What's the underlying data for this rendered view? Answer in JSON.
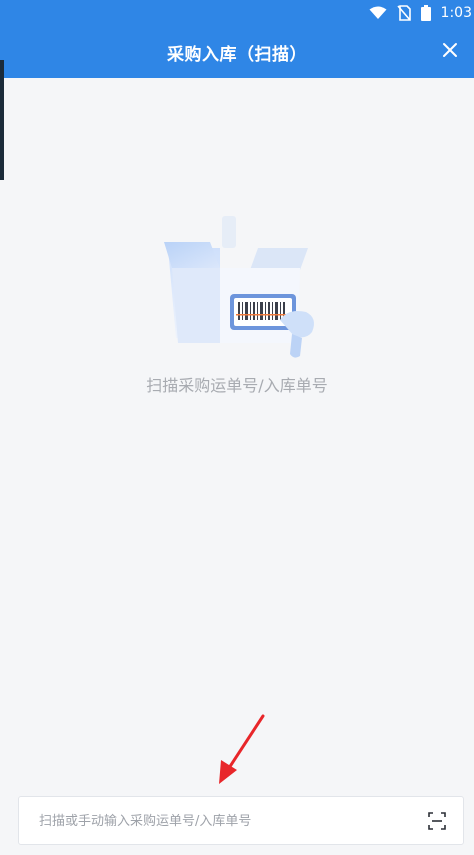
{
  "status": {
    "time": "1:03",
    "icons": [
      "wifi-icon",
      "no-sim-icon",
      "battery-icon"
    ]
  },
  "header": {
    "title": "采购入库（扫描）",
    "background": "#2f86e6"
  },
  "empty_state": {
    "message": "扫描采购运单号/入库单号",
    "illustration": "barcode-box-scanner-illustration"
  },
  "search": {
    "placeholder": "扫描或手动输入采购运单号/入库单号",
    "value": "",
    "scan_icon": "scan-icon"
  },
  "annotation": {
    "arrow_color": "#e8262a"
  }
}
